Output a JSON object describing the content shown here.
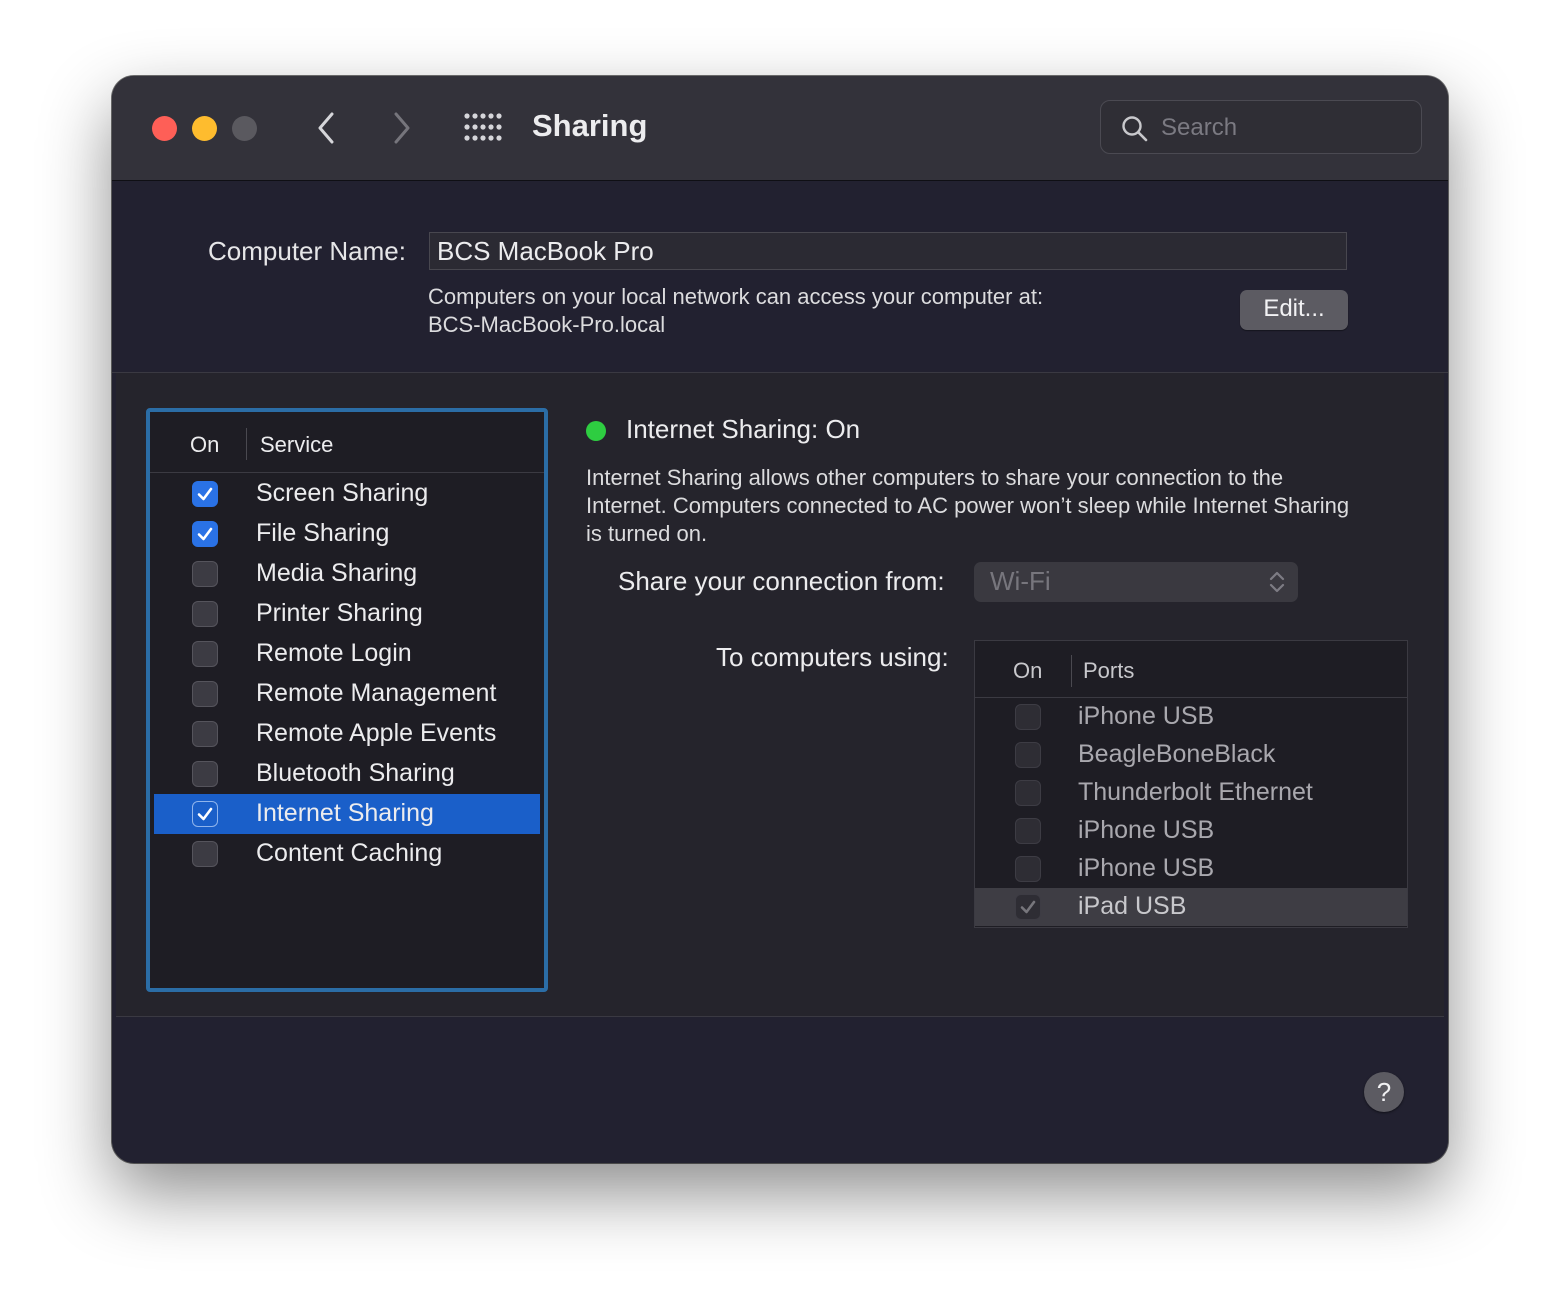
{
  "window": {
    "title": "Sharing",
    "search": {
      "placeholder": "Search",
      "value": ""
    }
  },
  "computer_name": {
    "label": "Computer Name:",
    "value": "BCS MacBook Pro",
    "description_line1": "Computers on your local network can access your computer at:",
    "description_line2": "BCS-MacBook-Pro.local",
    "edit_label": "Edit..."
  },
  "services": {
    "header_on": "On",
    "header_service": "Service",
    "items": [
      {
        "label": "Screen Sharing",
        "checked": true,
        "selected": false
      },
      {
        "label": "File Sharing",
        "checked": true,
        "selected": false
      },
      {
        "label": "Media Sharing",
        "checked": false,
        "selected": false
      },
      {
        "label": "Printer Sharing",
        "checked": false,
        "selected": false
      },
      {
        "label": "Remote Login",
        "checked": false,
        "selected": false
      },
      {
        "label": "Remote Management",
        "checked": false,
        "selected": false
      },
      {
        "label": "Remote Apple Events",
        "checked": false,
        "selected": false
      },
      {
        "label": "Bluetooth Sharing",
        "checked": false,
        "selected": false
      },
      {
        "label": "Internet Sharing",
        "checked": true,
        "selected": true
      },
      {
        "label": "Content Caching",
        "checked": false,
        "selected": false
      }
    ]
  },
  "detail": {
    "status_text": "Internet Sharing: On",
    "status_color": "#2ecd41",
    "description": "Internet Sharing allows other computers to share your connection to the Internet. Computers connected to AC power won’t sleep while Internet Sharing is turned on.",
    "share_from_label": "Share your connection from:",
    "share_from_value": "Wi-Fi",
    "to_computers_label": "To computers using:",
    "ports_header_on": "On",
    "ports_header_ports": "Ports",
    "ports": [
      {
        "label": "iPhone USB",
        "checked": false,
        "selected": false
      },
      {
        "label": "BeagleBoneBlack",
        "checked": false,
        "selected": false
      },
      {
        "label": "Thunderbolt Ethernet",
        "checked": false,
        "selected": false
      },
      {
        "label": "iPhone USB",
        "checked": false,
        "selected": false
      },
      {
        "label": "iPhone USB",
        "checked": false,
        "selected": false
      },
      {
        "label": "iPad USB",
        "checked": true,
        "selected": true
      }
    ]
  },
  "help_label": "?",
  "colors": {
    "accent": "#2a72e6",
    "selection": "#1a5fc9",
    "list_focus_ring": "#2b6da6"
  }
}
